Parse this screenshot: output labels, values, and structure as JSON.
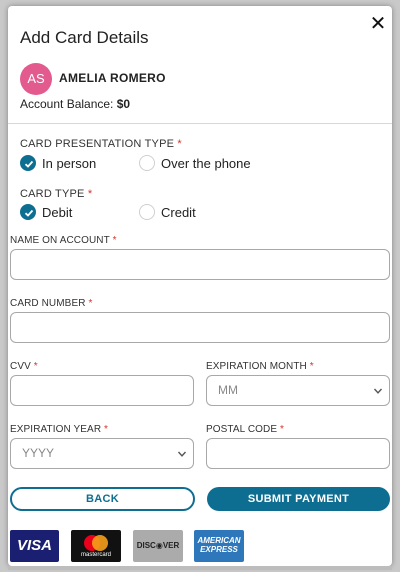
{
  "modal": {
    "title": "Add Card Details",
    "close_glyph": "✕"
  },
  "customer": {
    "initials": "AS",
    "name": "AMELIA ROMERO",
    "balance_label": "Account Balance:",
    "balance_value": "$0",
    "avatar_color": "#e35a8f"
  },
  "presentation": {
    "label": "CARD PRESENTATION TYPE",
    "required": "*",
    "options": [
      {
        "label": "In person",
        "checked": true
      },
      {
        "label": "Over the phone",
        "checked": false
      }
    ]
  },
  "card_type": {
    "label": "CARD TYPE",
    "required": "*",
    "options": [
      {
        "label": "Debit",
        "checked": true
      },
      {
        "label": "Credit",
        "checked": false
      }
    ]
  },
  "fields": {
    "name_on_account": {
      "label": "NAME ON ACCOUNT",
      "required": "*",
      "value": ""
    },
    "card_number": {
      "label": "CARD NUMBER",
      "required": "*",
      "value": ""
    },
    "cvv": {
      "label": "CVV",
      "required": "*",
      "value": ""
    },
    "exp_month": {
      "label": "EXPIRATION MONTH",
      "required": "*",
      "selected": "MM"
    },
    "exp_year": {
      "label": "EXPIRATION YEAR",
      "required": "*",
      "selected": "YYYY"
    },
    "postal_code": {
      "label": "POSTAL CODE",
      "required": "*",
      "value": ""
    }
  },
  "actions": {
    "back_label": "BACK",
    "submit_label": "SUBMIT PAYMENT"
  },
  "card_logos": {
    "visa": "VISA",
    "mastercard": "mastercard",
    "discover": "DISC◉VER",
    "amex_line1": "AMERICAN",
    "amex_line2": "EXPRESS"
  },
  "colors": {
    "accent": "#0e6e92",
    "required": "#d9302c"
  }
}
